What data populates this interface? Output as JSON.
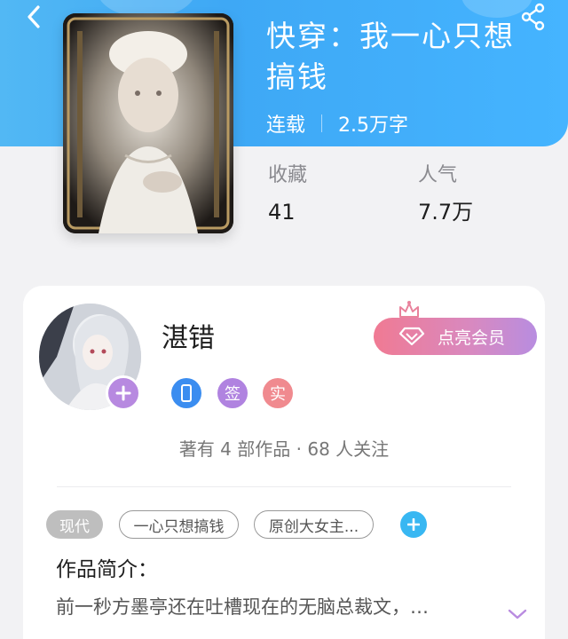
{
  "header": {
    "back_icon": "chevron-left-icon",
    "share_icon": "share-icon"
  },
  "book": {
    "cover_alt": "book-cover",
    "title": "快穿：我一心只想搞钱",
    "status": "连载",
    "word_count": "2.5万字",
    "stats": [
      {
        "label": "收藏",
        "value": "41"
      },
      {
        "label": "人气",
        "value": "7.7万"
      }
    ]
  },
  "author": {
    "name": "湛错",
    "badges": [
      {
        "icon": "phone-badge-icon",
        "text": "",
        "color": "#3b8df0"
      },
      {
        "icon": "sign-badge-icon",
        "text": "签",
        "color": "#b083e0"
      },
      {
        "icon": "verified-badge-icon",
        "text": "实",
        "color": "#f07c82"
      }
    ],
    "works_line": "著有 4 部作品 · 68 人关注",
    "vip_button": "点亮会员"
  },
  "tags": [
    {
      "label": "现代",
      "style": "filled"
    },
    {
      "label": "一心只想搞钱",
      "style": "outline"
    },
    {
      "label": "原创大女主...",
      "style": "outline"
    }
  ],
  "intro": {
    "title": "作品简介：",
    "text": "前一秒方墨亭还在吐槽现在的无脑总裁文，…"
  },
  "colors": {
    "header_blue": "#3ea8f5",
    "accent_purple": "#b789e0",
    "vip_pink": "#f07a93",
    "add_blue": "#38b7f2"
  }
}
